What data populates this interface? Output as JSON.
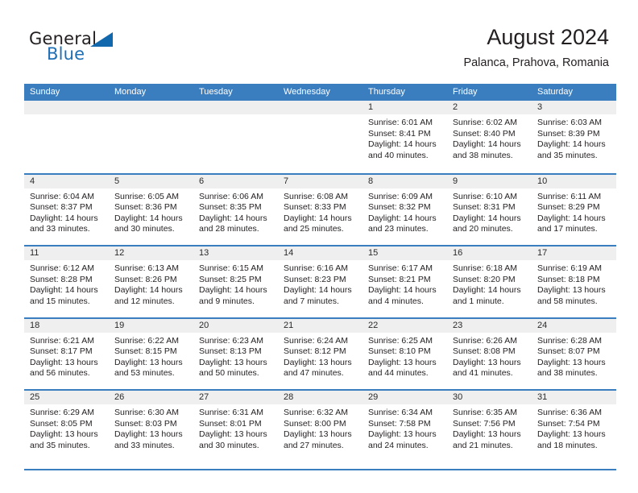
{
  "brand": {
    "name_part1": "General",
    "name_part2": "Blue",
    "accent_color": "#1268ad",
    "triangle_icon": "triangle-icon"
  },
  "header": {
    "title": "August 2024",
    "subtitle": "Palanca, Prahova, Romania"
  },
  "theme": {
    "header_row_color": "#3a7ec0",
    "day_number_band": "#efefef",
    "text_color": "#231f20"
  },
  "weekdays": [
    "Sunday",
    "Monday",
    "Tuesday",
    "Wednesday",
    "Thursday",
    "Friday",
    "Saturday"
  ],
  "weeks": [
    [
      {
        "day": "",
        "lines": []
      },
      {
        "day": "",
        "lines": []
      },
      {
        "day": "",
        "lines": []
      },
      {
        "day": "",
        "lines": []
      },
      {
        "day": "1",
        "lines": [
          "Sunrise: 6:01 AM",
          "Sunset: 8:41 PM",
          "Daylight: 14 hours",
          "and 40 minutes."
        ]
      },
      {
        "day": "2",
        "lines": [
          "Sunrise: 6:02 AM",
          "Sunset: 8:40 PM",
          "Daylight: 14 hours",
          "and 38 minutes."
        ]
      },
      {
        "day": "3",
        "lines": [
          "Sunrise: 6:03 AM",
          "Sunset: 8:39 PM",
          "Daylight: 14 hours",
          "and 35 minutes."
        ]
      }
    ],
    [
      {
        "day": "4",
        "lines": [
          "Sunrise: 6:04 AM",
          "Sunset: 8:37 PM",
          "Daylight: 14 hours",
          "and 33 minutes."
        ]
      },
      {
        "day": "5",
        "lines": [
          "Sunrise: 6:05 AM",
          "Sunset: 8:36 PM",
          "Daylight: 14 hours",
          "and 30 minutes."
        ]
      },
      {
        "day": "6",
        "lines": [
          "Sunrise: 6:06 AM",
          "Sunset: 8:35 PM",
          "Daylight: 14 hours",
          "and 28 minutes."
        ]
      },
      {
        "day": "7",
        "lines": [
          "Sunrise: 6:08 AM",
          "Sunset: 8:33 PM",
          "Daylight: 14 hours",
          "and 25 minutes."
        ]
      },
      {
        "day": "8",
        "lines": [
          "Sunrise: 6:09 AM",
          "Sunset: 8:32 PM",
          "Daylight: 14 hours",
          "and 23 minutes."
        ]
      },
      {
        "day": "9",
        "lines": [
          "Sunrise: 6:10 AM",
          "Sunset: 8:31 PM",
          "Daylight: 14 hours",
          "and 20 minutes."
        ]
      },
      {
        "day": "10",
        "lines": [
          "Sunrise: 6:11 AM",
          "Sunset: 8:29 PM",
          "Daylight: 14 hours",
          "and 17 minutes."
        ]
      }
    ],
    [
      {
        "day": "11",
        "lines": [
          "Sunrise: 6:12 AM",
          "Sunset: 8:28 PM",
          "Daylight: 14 hours",
          "and 15 minutes."
        ]
      },
      {
        "day": "12",
        "lines": [
          "Sunrise: 6:13 AM",
          "Sunset: 8:26 PM",
          "Daylight: 14 hours",
          "and 12 minutes."
        ]
      },
      {
        "day": "13",
        "lines": [
          "Sunrise: 6:15 AM",
          "Sunset: 8:25 PM",
          "Daylight: 14 hours",
          "and 9 minutes."
        ]
      },
      {
        "day": "14",
        "lines": [
          "Sunrise: 6:16 AM",
          "Sunset: 8:23 PM",
          "Daylight: 14 hours",
          "and 7 minutes."
        ]
      },
      {
        "day": "15",
        "lines": [
          "Sunrise: 6:17 AM",
          "Sunset: 8:21 PM",
          "Daylight: 14 hours",
          "and 4 minutes."
        ]
      },
      {
        "day": "16",
        "lines": [
          "Sunrise: 6:18 AM",
          "Sunset: 8:20 PM",
          "Daylight: 14 hours",
          "and 1 minute."
        ]
      },
      {
        "day": "17",
        "lines": [
          "Sunrise: 6:19 AM",
          "Sunset: 8:18 PM",
          "Daylight: 13 hours",
          "and 58 minutes."
        ]
      }
    ],
    [
      {
        "day": "18",
        "lines": [
          "Sunrise: 6:21 AM",
          "Sunset: 8:17 PM",
          "Daylight: 13 hours",
          "and 56 minutes."
        ]
      },
      {
        "day": "19",
        "lines": [
          "Sunrise: 6:22 AM",
          "Sunset: 8:15 PM",
          "Daylight: 13 hours",
          "and 53 minutes."
        ]
      },
      {
        "day": "20",
        "lines": [
          "Sunrise: 6:23 AM",
          "Sunset: 8:13 PM",
          "Daylight: 13 hours",
          "and 50 minutes."
        ]
      },
      {
        "day": "21",
        "lines": [
          "Sunrise: 6:24 AM",
          "Sunset: 8:12 PM",
          "Daylight: 13 hours",
          "and 47 minutes."
        ]
      },
      {
        "day": "22",
        "lines": [
          "Sunrise: 6:25 AM",
          "Sunset: 8:10 PM",
          "Daylight: 13 hours",
          "and 44 minutes."
        ]
      },
      {
        "day": "23",
        "lines": [
          "Sunrise: 6:26 AM",
          "Sunset: 8:08 PM",
          "Daylight: 13 hours",
          "and 41 minutes."
        ]
      },
      {
        "day": "24",
        "lines": [
          "Sunrise: 6:28 AM",
          "Sunset: 8:07 PM",
          "Daylight: 13 hours",
          "and 38 minutes."
        ]
      }
    ],
    [
      {
        "day": "25",
        "lines": [
          "Sunrise: 6:29 AM",
          "Sunset: 8:05 PM",
          "Daylight: 13 hours",
          "and 35 minutes."
        ]
      },
      {
        "day": "26",
        "lines": [
          "Sunrise: 6:30 AM",
          "Sunset: 8:03 PM",
          "Daylight: 13 hours",
          "and 33 minutes."
        ]
      },
      {
        "day": "27",
        "lines": [
          "Sunrise: 6:31 AM",
          "Sunset: 8:01 PM",
          "Daylight: 13 hours",
          "and 30 minutes."
        ]
      },
      {
        "day": "28",
        "lines": [
          "Sunrise: 6:32 AM",
          "Sunset: 8:00 PM",
          "Daylight: 13 hours",
          "and 27 minutes."
        ]
      },
      {
        "day": "29",
        "lines": [
          "Sunrise: 6:34 AM",
          "Sunset: 7:58 PM",
          "Daylight: 13 hours",
          "and 24 minutes."
        ]
      },
      {
        "day": "30",
        "lines": [
          "Sunrise: 6:35 AM",
          "Sunset: 7:56 PM",
          "Daylight: 13 hours",
          "and 21 minutes."
        ]
      },
      {
        "day": "31",
        "lines": [
          "Sunrise: 6:36 AM",
          "Sunset: 7:54 PM",
          "Daylight: 13 hours",
          "and 18 minutes."
        ]
      }
    ]
  ]
}
